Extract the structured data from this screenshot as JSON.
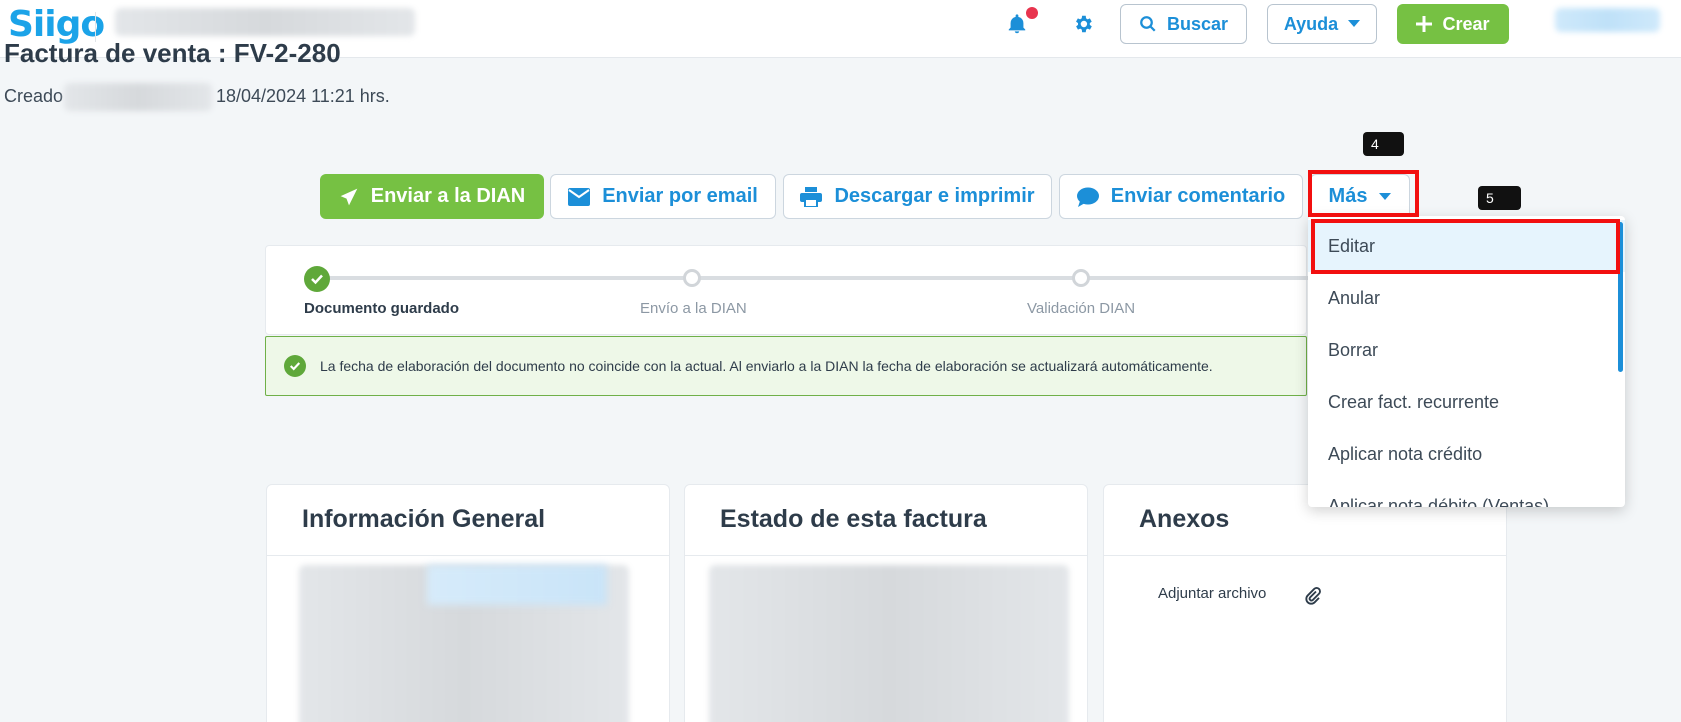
{
  "header": {
    "logo": "Siigo",
    "search_label": "Buscar",
    "help_label": "Ayuda",
    "create_label": "Crear"
  },
  "page": {
    "title": "Factura de venta : FV-2-280",
    "created_label": "Creado",
    "created_date": "18/04/2024 11:21 hrs."
  },
  "actions": {
    "send_dian": "Enviar a la DIAN",
    "send_email": "Enviar por email",
    "download_print": "Descargar e imprimir",
    "send_comment": "Enviar comentario",
    "more": "Más"
  },
  "annotations": {
    "tag_4": "4",
    "tag_5": "5"
  },
  "progress": {
    "steps": [
      "Documento guardado",
      "Envío a la DIAN",
      "Validación DIAN"
    ]
  },
  "notice": {
    "text": "La fecha de elaboración del documento no coincide con la actual. Al enviarlo a la DIAN la fecha de elaboración se actualizará automáticamente."
  },
  "cards": {
    "general_info_title": "Información General",
    "status_title": "Estado de esta factura",
    "attachments_title": "Anexos",
    "attach_label": "Adjuntar archivo"
  },
  "more_menu": {
    "items": [
      "Editar",
      "Anular",
      "Borrar",
      "Crear fact. recurrente",
      "Aplicar nota crédito",
      "Aplicar nota débito (Ventas)"
    ]
  }
}
